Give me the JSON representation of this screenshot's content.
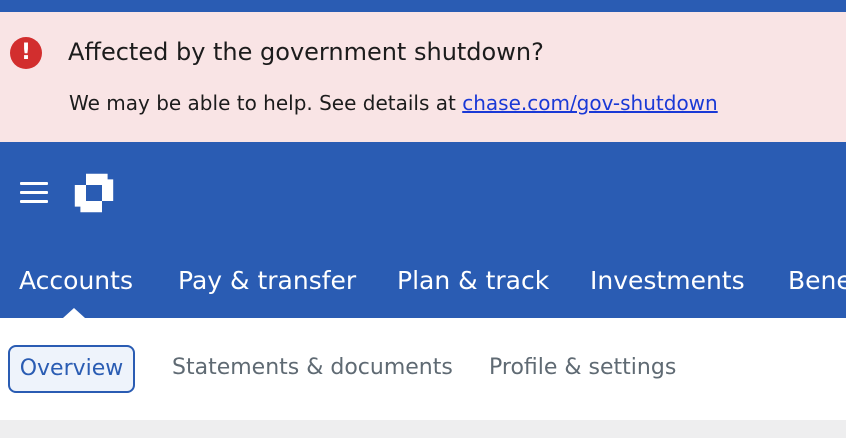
{
  "alert": {
    "icon": "exclamation-icon",
    "icon_glyph": "!",
    "title": "Affected by the government shutdown?",
    "body_text": "We may be able to help. See details at ",
    "link_text": "chase.com/gov-shutdown",
    "background_color": "#f9e4e5",
    "icon_color": "#d22e2e"
  },
  "header": {
    "menu_icon": "hamburger-menu-icon",
    "logo_icon": "chase-octagon-logo",
    "background_color": "#2a5cb3",
    "nav": [
      {
        "label": "Accounts",
        "active": true
      },
      {
        "label": "Pay & transfer"
      },
      {
        "label": "Plan & track"
      },
      {
        "label": "Investments"
      },
      {
        "label": "Bene"
      }
    ]
  },
  "subnav": {
    "tabs": [
      {
        "label": "Overview",
        "active": true
      },
      {
        "label": "Statements & documents"
      },
      {
        "label": "Profile & settings"
      }
    ]
  }
}
